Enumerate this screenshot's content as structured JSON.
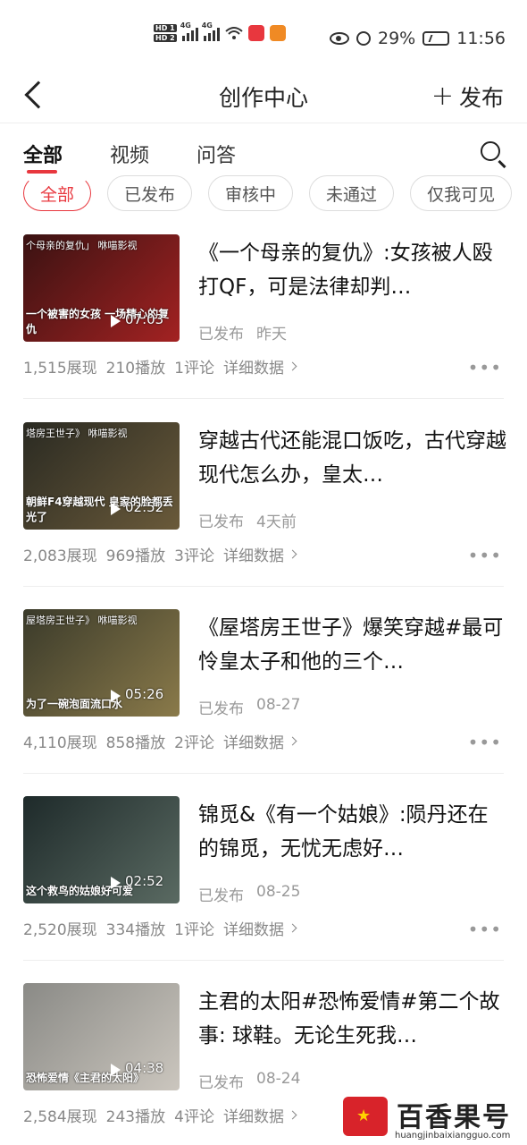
{
  "status_bar": {
    "left_hd": [
      "HD 1",
      "HD 2"
    ],
    "net1": "4G",
    "net2": "4G",
    "battery_pct": "29%",
    "time": "11:56"
  },
  "header": {
    "title": "创作中心",
    "publish_label": "发布"
  },
  "tabs": [
    "全部",
    "视频",
    "问答"
  ],
  "chips": [
    "全部",
    "已发布",
    "审核中",
    "未通过",
    "仅我可见"
  ],
  "items": [
    {
      "thumb_top": "个母亲的复仇」 咻喵影视",
      "thumb_bottom": "一个被害的女孩 一场精心的复仇",
      "duration": "07:03",
      "title": "《一个母亲的复仇》:女孩被人殴打QF，可是法律却判…",
      "status": "已发布",
      "date": "昨天",
      "impressions": "1,515展现",
      "plays": "210播放",
      "comments": "1评论",
      "detail": "详细数据",
      "colors": [
        "#3a1212",
        "#a32222"
      ]
    },
    {
      "thumb_top": "塔房王世子》 咻喵影视",
      "thumb_bottom": "朝鲜F4穿越现代 皇家的脸都丢光了",
      "duration": "02:52",
      "title": "穿越古代还能混口饭吃，古代穿越现代怎么办，皇太…",
      "status": "已发布",
      "date": "4天前",
      "impressions": "2,083展现",
      "plays": "969播放",
      "comments": "3评论",
      "detail": "详细数据",
      "colors": [
        "#2a2a22",
        "#6a5a3a"
      ]
    },
    {
      "thumb_top": "屋塔房王世子》 咻喵影视",
      "thumb_bottom": "为了一碗泡面流口水",
      "duration": "05:26",
      "title": "《屋塔房王世子》爆笑穿越#最可怜皇太子和他的三个…",
      "status": "已发布",
      "date": "08-27",
      "impressions": "4,110展现",
      "plays": "858播放",
      "comments": "2评论",
      "detail": "详细数据",
      "colors": [
        "#3a3a2a",
        "#8a7a4a"
      ]
    },
    {
      "thumb_top": "",
      "thumb_bottom": "这个救鸟的姑娘好可爱",
      "duration": "02:52",
      "title": "锦觅&《有一个姑娘》:陨丹还在的锦觅，无忧无虑好…",
      "status": "已发布",
      "date": "08-25",
      "impressions": "2,520展现",
      "plays": "334播放",
      "comments": "1评论",
      "detail": "详细数据",
      "colors": [
        "#1e2a2a",
        "#5a6a62"
      ]
    },
    {
      "thumb_top": "",
      "thumb_bottom": "恐怖爱情《主君的太阳》",
      "duration": "04:38",
      "title": "主君的太阳#恐怖爱情#第二个故事: 球鞋。无论生死我…",
      "status": "已发布",
      "date": "08-24",
      "impressions": "2,584展现",
      "plays": "243播放",
      "comments": "4评论",
      "detail": "详细数据",
      "colors": [
        "#8a8a86",
        "#cbc6be"
      ]
    }
  ],
  "watermark": {
    "text": "百香果号",
    "url": "huangjinbaixiangguo.com"
  }
}
